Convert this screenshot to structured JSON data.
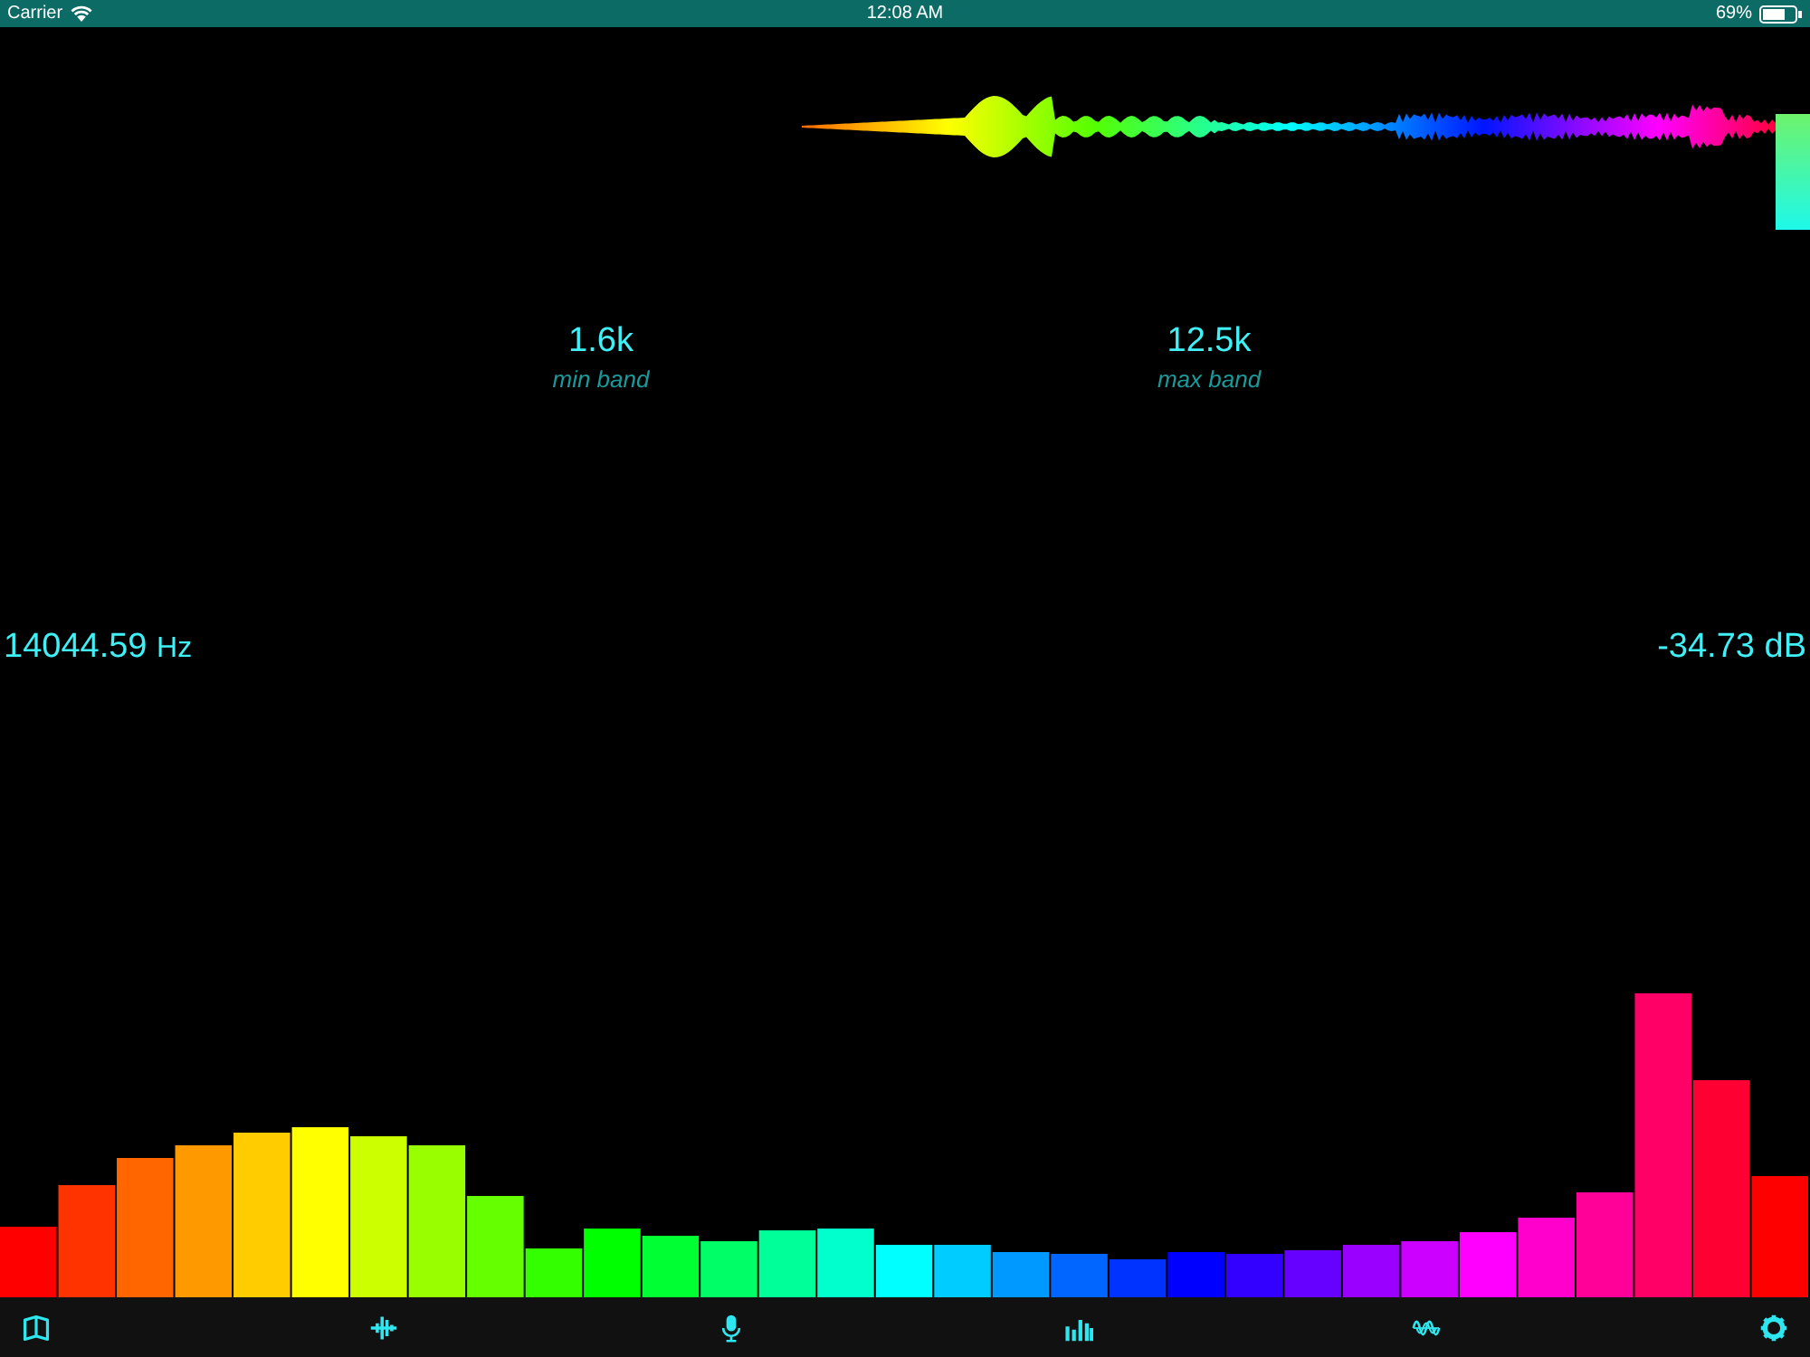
{
  "status_bar": {
    "carrier": "Carrier",
    "time": "12:08 AM",
    "battery": "69%"
  },
  "bands": [
    {
      "value": "1.6k",
      "label": "min band"
    },
    {
      "value": "12.5k",
      "label": "max band"
    }
  ],
  "readouts": {
    "frequency": "14044.59",
    "frequency_unit": "Hz",
    "level": "-34.73 dB"
  },
  "tab_bar": [
    {
      "kind": "book"
    },
    {
      "kind": "waveform"
    },
    {
      "kind": "microphone"
    },
    {
      "kind": "bars"
    },
    {
      "kind": "sine"
    },
    {
      "kind": "gear"
    }
  ]
}
